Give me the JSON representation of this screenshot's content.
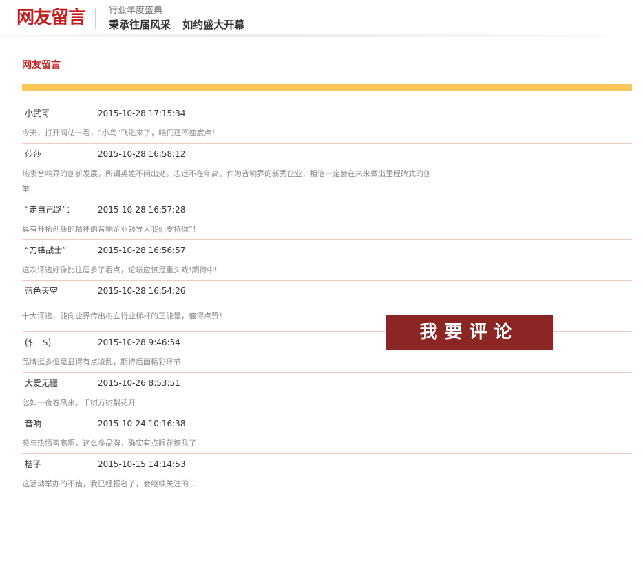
{
  "header": {
    "logo": "网友留言",
    "tagline_top": "行业年度盛典",
    "tagline_main": "秉承往届风采 如约盛大开幕"
  },
  "section": {
    "title": "网友留言"
  },
  "comments": [
    {
      "author": "小武哥",
      "time": "2015-10-28 17:15:34",
      "content": "今天，打开网站一看，“小鸟”飞进来了，咱们还不速度点！"
    },
    {
      "author": "莎莎",
      "time": "2015-10-28 16:58:12",
      "content": "热衷音响界的创新发展，所谓英雄不问出处，志远不在年高。作为音响界的新秀企业，相信一定会在未来做出里程碑式的创举"
    },
    {
      "author": "“走自己路“：",
      "time": "2015-10-28 16:57:28",
      "content": "具有开拓创新的精神的音响企业领导人我们支持你”！"
    },
    {
      "author": "“刀锋战士“",
      "time": "2015-10-28 16:56:57",
      "content": "这次评选好像比往届多了看点，论坛应该是重头戏!期待中!"
    },
    {
      "author": "蓝色天空",
      "time": "2015-10-28 16:54:26",
      "content": "十大评选，能向业界传出树立行业标杆的正能量，值得点赞！"
    },
    {
      "author": "($ _ $)",
      "time": "2015-10-28 9:46:54",
      "content": "品牌挺多但是显得有点凌乱，期待后面精彩环节"
    },
    {
      "author": "大爱无疆",
      "time": "2015-10-26 8:53:51",
      "content": "忽如一夜春风来，千树万树梨花开"
    },
    {
      "author": "音响",
      "time": "2015-10-24 10:16:38",
      "content": "参与热情蛮高啊，这么多品牌，确实有点眼花撩乱了"
    },
    {
      "author": "桔子",
      "time": "2015-10-15 14:14:53",
      "content": "这活动举办的不错，我已经报名了，会继续关注的..."
    }
  ],
  "actions": {
    "comment_button": "我要评论"
  },
  "colors": {
    "brand_red": "#c41f1f",
    "button_red": "#8c2625",
    "accent_yellow": "#fdc65a",
    "divider_pink": "#f3c9c0"
  }
}
